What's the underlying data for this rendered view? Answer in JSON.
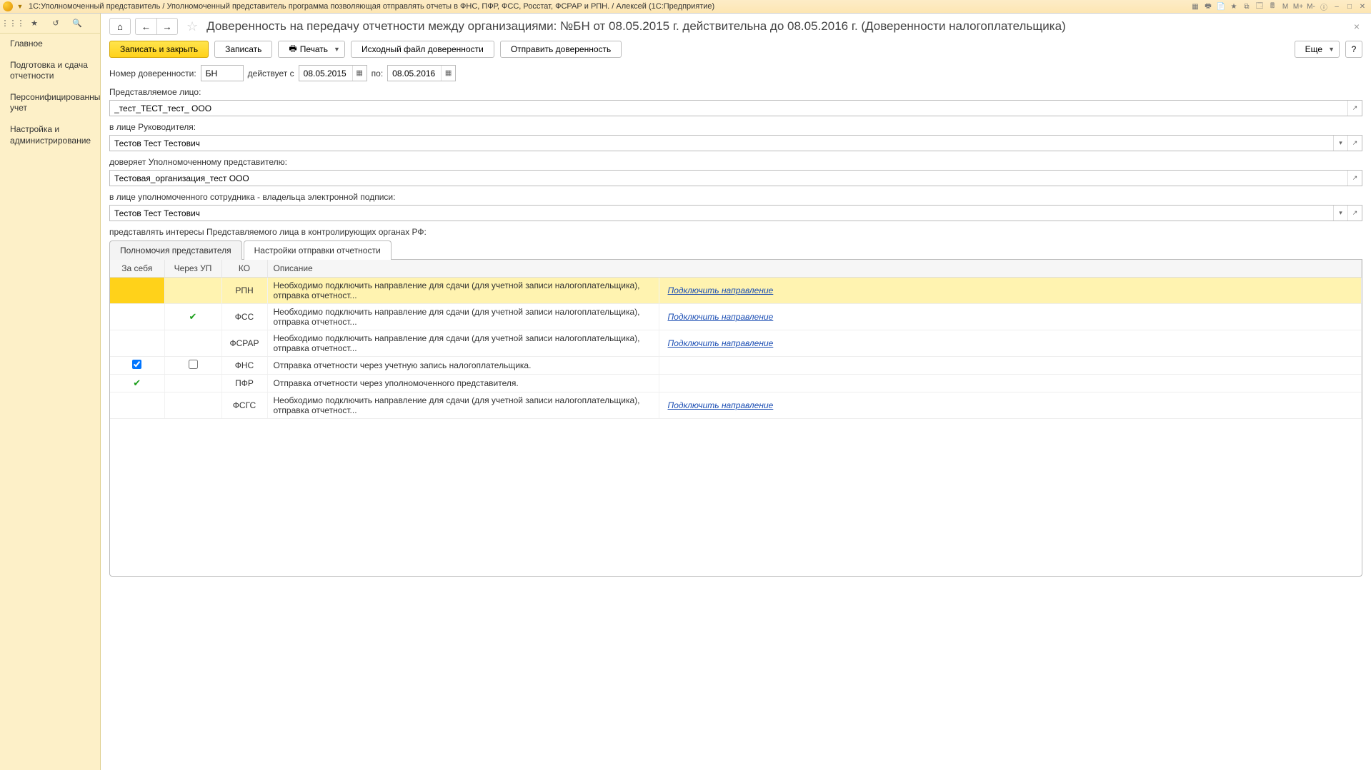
{
  "titlebar": {
    "text": "1С:Уполномоченный представитель / Уполномоченный представитель программа позволяющая отправлять отчеты в ФНС, ПФР, ФСС, Росстат, ФСРАР и РПН. / Алексей  (1С:Предприятие)",
    "mcalc": [
      "M",
      "M+",
      "M-"
    ]
  },
  "sidebar": {
    "items": [
      "Главное",
      "Подготовка и сдача отчетности",
      "Персонифицированный учет",
      "Настройка и администрирование"
    ]
  },
  "page": {
    "title": "Доверенность на передачу отчетности между организациями: №БН от 08.05.2015 г. действительна до 08.05.2016 г. (Доверенности налогоплательщика)"
  },
  "toolbar": {
    "save_close": "Записать и закрыть",
    "save": "Записать",
    "print": "Печать",
    "source_file": "Исходный файл доверенности",
    "send": "Отправить доверенность",
    "more": "Еще",
    "help": "?"
  },
  "form": {
    "number_label": "Номер доверенности:",
    "number_value": "БН",
    "valid_from_label": "действует с",
    "valid_from": "08.05.2015",
    "valid_to_label": "по:",
    "valid_to": "08.05.2016",
    "org_label": "Представляемое лицо:",
    "org_value": "_тест_ТЕСТ_тест_ ООО",
    "head_label": "в лице Руководителя:",
    "head_value": "Тестов Тест Тестович",
    "rep_label": "доверяет Уполномоченному представителю:",
    "rep_value": "Тестовая_организация_тест ООО",
    "emp_label": "в лице уполномоченного сотрудника  - владельца электронной подписи:",
    "emp_value": "Тестов Тест Тестович",
    "interests_label": "представлять интересы Представляемого лица в контролирующих органах РФ:"
  },
  "tabs": {
    "t1": "Полномочия представителя",
    "t2": "Настройки отправки отчетности"
  },
  "table": {
    "headers": {
      "self": "За себя",
      "via": "Через УП",
      "ko": "КО",
      "desc": "Описание"
    },
    "connect_link": "Подключить направление",
    "rows": [
      {
        "self": "",
        "via": "",
        "ko": "РПН",
        "desc": "Необходимо подключить направление для сдачи (для учетной записи налогоплательщика), отправка отчетност...",
        "link": true,
        "sel": true
      },
      {
        "self": "",
        "via": "check",
        "ko": "ФСС",
        "desc": "Необходимо подключить направление для сдачи (для учетной записи налогоплательщика), отправка отчетност...",
        "link": true
      },
      {
        "self": "",
        "via": "",
        "ko": "ФСРАР",
        "desc": "Необходимо подключить направление для сдачи (для учетной записи налогоплательщика), отправка отчетност...",
        "link": true
      },
      {
        "self": "checkbox-on",
        "via": "checkbox-off",
        "ko": "ФНС",
        "desc": "Отправка отчетности через учетную запись налогоплательщика.",
        "link": false
      },
      {
        "self": "check",
        "via": "",
        "ko": "ПФР",
        "desc": "Отправка отчетности через уполномоченного представителя.",
        "link": false
      },
      {
        "self": "",
        "via": "",
        "ko": "ФСГС",
        "desc": "Необходимо подключить направление для сдачи (для учетной записи налогоплательщика), отправка отчетност...",
        "link": true
      }
    ]
  }
}
